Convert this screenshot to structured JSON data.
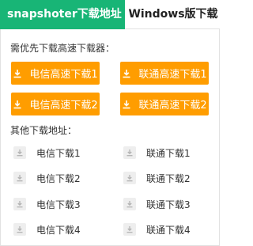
{
  "tabs": {
    "active_label": "snapshoter下载地址",
    "inactive_label": "Windows版下载"
  },
  "fast_section": {
    "title": "需优先下载高速下载器：",
    "buttons": [
      {
        "label": "电信高速下载1",
        "icon": "download-icon"
      },
      {
        "label": "联通高速下载1",
        "icon": "download-icon"
      },
      {
        "label": "电信高速下载2",
        "icon": "download-icon"
      },
      {
        "label": "联通高速下载2",
        "icon": "download-icon"
      }
    ]
  },
  "other_section": {
    "title": "其他下载地址：",
    "links": [
      {
        "label": "电信下载1",
        "icon": "download-icon"
      },
      {
        "label": "联通下载1",
        "icon": "download-icon"
      },
      {
        "label": "电信下载2",
        "icon": "download-icon"
      },
      {
        "label": "联通下载2",
        "icon": "download-icon"
      },
      {
        "label": "电信下载3",
        "icon": "download-icon"
      },
      {
        "label": "联通下载3",
        "icon": "download-icon"
      },
      {
        "label": "电信下载4",
        "icon": "download-icon"
      },
      {
        "label": "联通下载4",
        "icon": "download-icon"
      }
    ]
  },
  "colors": {
    "tab_active": "#18b576",
    "button_accent": "#ff9d00",
    "icon_box": "#eeeeee",
    "border": "#e2e2e2"
  }
}
